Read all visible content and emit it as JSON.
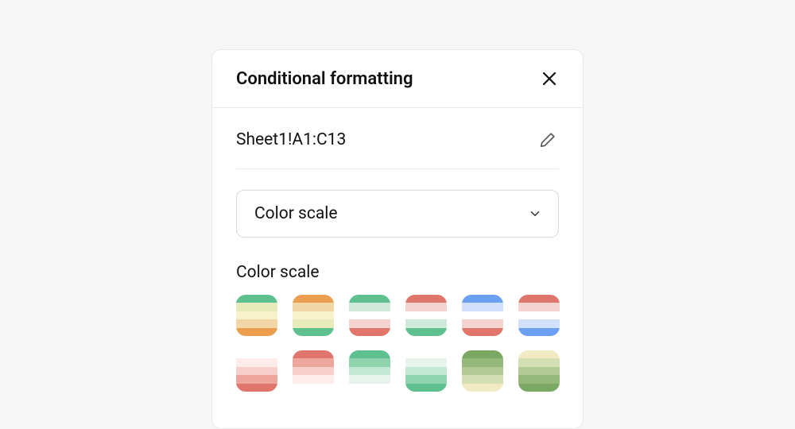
{
  "panel": {
    "title": "Conditional formatting",
    "range": "Sheet1!A1:C13",
    "rule_type": "Color scale",
    "section_label": "Color scale"
  },
  "icons": {
    "close": "close-icon",
    "edit": "pencil-icon",
    "chevron": "chevron-down-icon"
  },
  "swatches": [
    {
      "name": "green-yellow-orange",
      "stops": [
        "#5ec08e",
        "#e7ebba",
        "#f7f2cb",
        "#f0d7a5",
        "#eb9f4e"
      ]
    },
    {
      "name": "orange-yellow-green",
      "stops": [
        "#eb9f4e",
        "#f0d7a5",
        "#f7f2cb",
        "#e7ebba",
        "#5ec08e"
      ]
    },
    {
      "name": "green-white-red",
      "stops": [
        "#5ec08e",
        "#cfeadb",
        "#ffffff",
        "#f5d4cf",
        "#e0766b"
      ]
    },
    {
      "name": "red-white-green",
      "stops": [
        "#e0766b",
        "#f5d4cf",
        "#ffffff",
        "#cfeadb",
        "#5ec08e"
      ]
    },
    {
      "name": "blue-white-red",
      "stops": [
        "#6a9ff2",
        "#d1e0fb",
        "#ffffff",
        "#f5d4cf",
        "#e0766b"
      ]
    },
    {
      "name": "red-white-blue",
      "stops": [
        "#e0766b",
        "#f5d4cf",
        "#ffffff",
        "#d1e0fb",
        "#6a9ff2"
      ]
    },
    {
      "name": "white-red",
      "stops": [
        "#ffffff",
        "#fdecea",
        "#f7cfca",
        "#eea59c",
        "#e0766b"
      ]
    },
    {
      "name": "red-white",
      "stops": [
        "#e0766b",
        "#eea59c",
        "#f7cfca",
        "#fdecea",
        "#ffffff"
      ]
    },
    {
      "name": "green-white",
      "stops": [
        "#5ec08e",
        "#8fd4ad",
        "#c2e7d2",
        "#e6f4ec",
        "#ffffff"
      ]
    },
    {
      "name": "white-green",
      "stops": [
        "#ffffff",
        "#e6f4ec",
        "#c2e7d2",
        "#8fd4ad",
        "#5ec08e"
      ]
    },
    {
      "name": "green-yellow",
      "stops": [
        "#7aa863",
        "#94b97b",
        "#b2cb95",
        "#d4deb4",
        "#f2eac2"
      ]
    },
    {
      "name": "yellow-green",
      "stops": [
        "#f2eac2",
        "#d4deb4",
        "#b2cb95",
        "#94b97b",
        "#7aa863"
      ]
    }
  ]
}
